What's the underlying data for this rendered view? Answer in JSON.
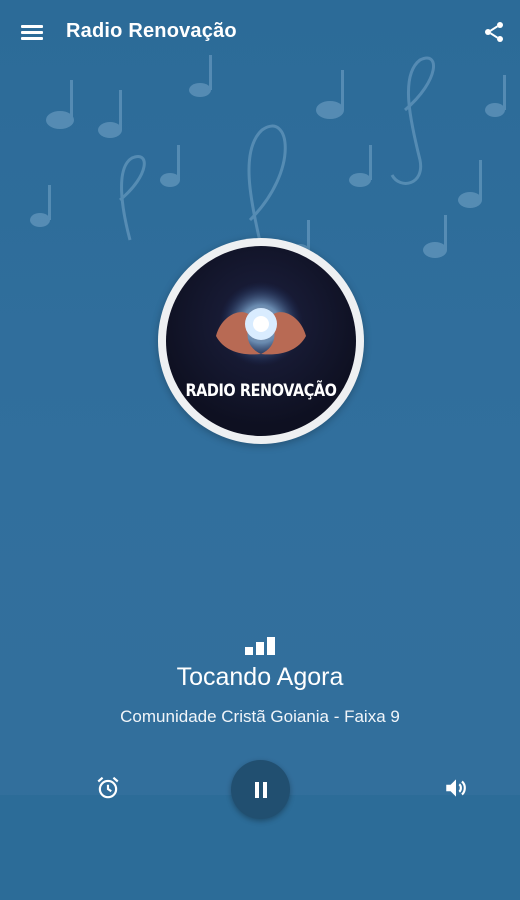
{
  "app": {
    "title": "Radio Renovação"
  },
  "toolbar": {
    "menu_icon": "menu-icon",
    "share_icon": "share-icon"
  },
  "station": {
    "logo_text": "RADIO RENOVAÇÃO"
  },
  "player": {
    "status": "Tocando Agora",
    "track": "Comunidade Cristã Goiania - Faixa 9",
    "signal_icon": "signal-bars-icon",
    "alarm_icon": "alarm-clock-icon",
    "pause_icon": "pause-icon",
    "volume_icon": "volume-icon"
  },
  "colors": {
    "background": "#2f6e9c",
    "play_button": "#214f70",
    "logo_ring": "#eef0f2"
  }
}
